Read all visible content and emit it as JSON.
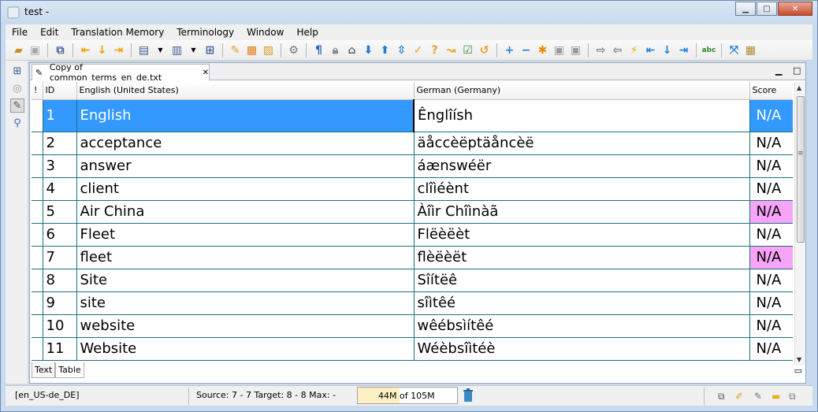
{
  "window": {
    "title": "test -",
    "minimize": "▁",
    "maximize": "□",
    "close": "✕"
  },
  "menu": [
    "File",
    "Edit",
    "Translation Memory",
    "Terminology",
    "Window",
    "Help"
  ],
  "toolbar_icons": [
    "open-icon",
    "save-icon",
    "sync-icon",
    "prev-segment-icon",
    "down-icon",
    "next-segment-icon",
    "edit-icon",
    "dropdown-icon",
    "import-icon",
    "dropdown-icon",
    "export-icon",
    "approve-icon",
    "approve-all-icon",
    "translate-icon",
    "settings-icon",
    "pilcrow-icon",
    "lock-icon",
    "tag-icon",
    "move-down-icon",
    "move-up-icon",
    "jump-icon",
    "confirm-icon",
    "query-icon",
    "fuzzy-icon",
    "check-icon",
    "undo-icon",
    "add-icon",
    "remove-icon",
    "star-icon",
    "merge-icon",
    "split-icon",
    "send-icon",
    "copy-source-icon",
    "lightning-icon",
    "first-icon",
    "down-arrow-icon",
    "last-icon",
    "spellcheck-icon",
    "fullscreen-icon",
    "layout-icon"
  ],
  "editor_tab": {
    "label": "Copy of common_terms_en_de.txt",
    "close": "✕"
  },
  "columns": {
    "flag": "!",
    "id": "ID",
    "source": "English (United States)",
    "target": "German (Germany)",
    "score": "Score"
  },
  "rows": [
    {
      "id": "1",
      "source": "English",
      "target": "Ênglîísh",
      "score": "N/A",
      "state": "selected"
    },
    {
      "id": "2",
      "source": "acceptance",
      "target": "äåccèëptäåncèë",
      "score": "N/A",
      "state": ""
    },
    {
      "id": "3",
      "source": "answer",
      "target": "áænswéër",
      "score": "N/A",
      "state": ""
    },
    {
      "id": "4",
      "source": "client",
      "target": "clîìéènt",
      "score": "N/A",
      "state": ""
    },
    {
      "id": "5",
      "source": "Air China",
      "target": "Àîìr Chîìnàã",
      "score": "N/A",
      "state": "pink"
    },
    {
      "id": "6",
      "source": "Fleet",
      "target": "Flëèëèt",
      "score": "N/A",
      "state": ""
    },
    {
      "id": "7",
      "source": "fleet",
      "target": "flèëèët",
      "score": "N/A",
      "state": "pink"
    },
    {
      "id": "8",
      "source": "Site",
      "target": "Sîítëê",
      "score": "N/A",
      "state": ""
    },
    {
      "id": "9",
      "source": "site",
      "target": "sîìtêé",
      "score": "N/A",
      "state": ""
    },
    {
      "id": "10",
      "source": "website",
      "target": "wêébsìítêé",
      "score": "N/A",
      "state": ""
    },
    {
      "id": "11",
      "source": "Website",
      "target": "Wéèbsîìtéè",
      "score": "N/A",
      "state": ""
    }
  ],
  "bottom_tabs": [
    "Text",
    "Table"
  ],
  "status": {
    "lang_pair": "[en_US-de_DE]",
    "position": "Source:  7 - 7  Target:  8 - 8  Max:  -",
    "heap_used": "44M",
    "heap_total": "of 105M",
    "heap_fraction": 0.42
  },
  "colors": {
    "selected": "#3399ff",
    "pink": "#f7a3f7",
    "gridline": "#1e6f80"
  }
}
